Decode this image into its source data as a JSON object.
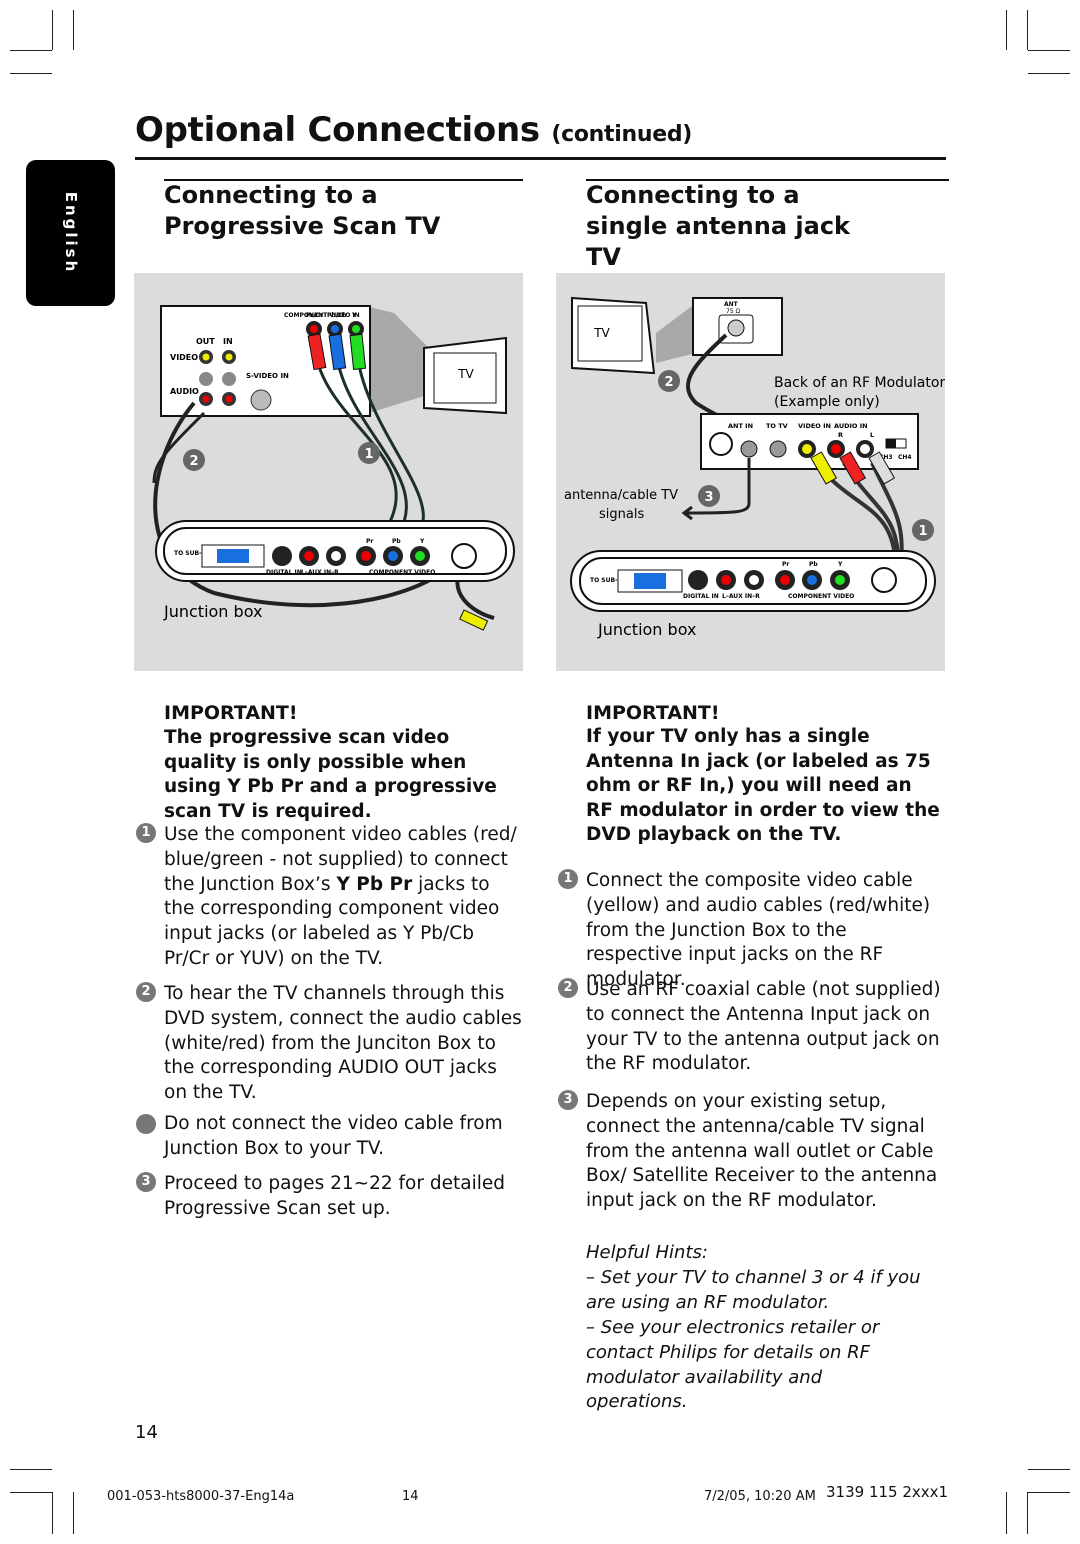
{
  "page": {
    "title": "Optional Connections",
    "title_suffix": "(continued)",
    "side_tab": "English",
    "page_number": "14"
  },
  "left": {
    "heading": "Connecting to a Progressive Scan TV",
    "figure": {
      "tv": "TV",
      "component_video_in": "COMPONENT VIDEO IN",
      "pr_cr": "Pr/Cr",
      "pb_cb": "Pb/Cb",
      "y": "Y",
      "out": "OUT",
      "in": "IN",
      "video": "VIDEO",
      "audio": "AUDIO",
      "s_video_in": "S-VIDEO IN",
      "to_subwoofer": "TO SUB-WOOFER",
      "digital_in": "DIGITAL IN",
      "aux_in": "L–AUX IN–R",
      "component_video": "COMPONENT VIDEO",
      "pr": "Pr",
      "pb": "Pb",
      "junction_box": "Junction box",
      "step1": "1",
      "step2": "2"
    },
    "important_heading": "IMPORTANT!",
    "important_body": "The progressive scan video quality is only possible when using Y Pb Pr and a progressive scan TV is required.",
    "items": [
      {
        "marker": "1",
        "pre": "Use the component video cables (red/ blue/green - not supplied) to connect the Junction Box’s ",
        "bold": "Y Pb Pr",
        "post": " jacks to the corresponding component video input jacks (or labeled as Y Pb/Cb Pr/Cr or YUV) on the TV."
      },
      {
        "marker": "2",
        "text": "To hear the TV channels through this DVD system, connect the audio cables (white/red) from the Junciton Box to the corresponding AUDIO OUT jacks on the TV."
      },
      {
        "marker": "",
        "text": "Do not connect the video cable from Junction Box to your TV."
      },
      {
        "marker": "3",
        "text": "Proceed to pages 21~22 for detailed Progressive Scan set up."
      }
    ]
  },
  "right": {
    "heading": "Connecting to a single antenna jack TV",
    "figure": {
      "tv": "TV",
      "ant": "ANT",
      "ohm": "75 Ω",
      "rf_caption_1": "Back of an RF Modulator",
      "rf_caption_2": "(Example only)",
      "ant_in": "ANT IN",
      "to_tv": "TO TV",
      "video_in": "VIDEO IN",
      "audio_in": "AUDIO IN",
      "r": "R",
      "l": "L",
      "ch3": "CH3",
      "ch4": "CH4",
      "signals_1": "antenna/cable TV",
      "signals_2": "signals",
      "to_subwoofer": "TO SUB-WOOFER",
      "digital_in": "DIGITAL IN",
      "aux_in": "L–AUX IN–R",
      "component_video": "COMPONENT VIDEO",
      "pr": "Pr",
      "pb": "Pb",
      "y": "Y",
      "junction_box": "Junction box",
      "step1": "1",
      "step2": "2",
      "step3": "3"
    },
    "important_heading": "IMPORTANT!",
    "important_body": "If your TV only has a single Antenna In jack (or labeled as 75 ohm or RF In,) you will need an RF modulator in order to view the DVD playback on the TV.",
    "items": [
      {
        "marker": "1",
        "text": "Connect the composite video cable (yellow) and audio cables (red/white) from the Junction Box to the respective input jacks on the RF modulator."
      },
      {
        "marker": "2",
        "text": "Use an RF coaxial cable (not supplied) to connect the Antenna Input jack on your TV to the antenna output jack on the RF modulator."
      },
      {
        "marker": "3",
        "text": "Depends on your existing setup, connect the antenna/cable TV signal from the antenna wall outlet or Cable Box/ Satellite Receiver to the antenna input jack on the RF modulator."
      }
    ],
    "hints": {
      "heading": "Helpful Hints:",
      "lines": [
        "–  Set your TV to channel 3 or 4 if you are using an RF modulator.",
        "–  See your electronics retailer or contact Philips for details on RF modulator availability and operations."
      ]
    }
  },
  "footer": {
    "file": "001-053-hts8000-37-Eng14a",
    "page": "14",
    "date": "7/2/05, 10:20 AM",
    "code": "3139 115 2xxx1"
  }
}
